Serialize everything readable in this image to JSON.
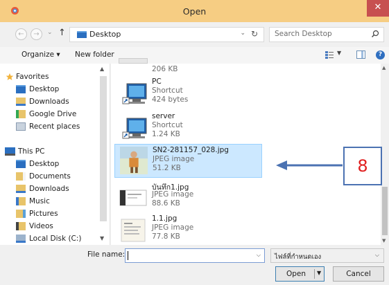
{
  "window": {
    "title": "Open",
    "close_glyph": "✕"
  },
  "navbar": {
    "back_glyph": "←",
    "forward_glyph": "→",
    "recent_glyph": "⌄",
    "up_glyph": "↑",
    "address": "Desktop",
    "refresh_glyph": "↻",
    "search_placeholder": "Search Desktop"
  },
  "toolbar": {
    "organize_label": "Organize ▾",
    "new_folder_label": "New folder",
    "help_glyph": "?"
  },
  "sidebar": {
    "favorites_label": "Favorites",
    "favorites": [
      {
        "label": "Desktop",
        "icon": "desktop-icon"
      },
      {
        "label": "Downloads",
        "icon": "downloads-icon"
      },
      {
        "label": "Google Drive",
        "icon": "google-drive-icon"
      },
      {
        "label": "Recent places",
        "icon": "recent-places-icon"
      }
    ],
    "this_pc_label": "This PC",
    "this_pc": [
      {
        "label": "Desktop",
        "icon": "desktop-icon"
      },
      {
        "label": "Documents",
        "icon": "documents-icon"
      },
      {
        "label": "Downloads",
        "icon": "downloads-icon"
      },
      {
        "label": "Music",
        "icon": "music-icon"
      },
      {
        "label": "Pictures",
        "icon": "pictures-icon"
      },
      {
        "label": "Videos",
        "icon": "videos-icon"
      },
      {
        "label": "Local Disk (C:)",
        "icon": "local-disk-icon"
      }
    ]
  },
  "files": [
    {
      "size": "206 KB"
    },
    {
      "name": "PC",
      "type": "Shortcut",
      "size": "424 bytes",
      "icon": "pc-shortcut-icon"
    },
    {
      "name": "server",
      "type": "Shortcut",
      "size": "1.24 KB",
      "icon": "server-shortcut-icon"
    },
    {
      "name": "SN2-281157_028.jpg",
      "type": "JPEG image",
      "size": "51.2 KB",
      "icon": "photo-thumbnail",
      "selected": true
    },
    {
      "name": "บันทึก1.jpg",
      "type": "JPEG image",
      "size": "88.6 KB",
      "icon": "screenshot-thumbnail"
    },
    {
      "name": "1.1.jpg",
      "type": "JPEG image",
      "size": "77.8 KB",
      "icon": "document-thumbnail"
    }
  ],
  "annotation": {
    "number": "8",
    "color": "#4b72b2",
    "number_color": "#e02020"
  },
  "bottom": {
    "file_name_label": "File name:",
    "file_name_value": "",
    "filter_value": "ไฟล์ที่กำหนดเอง",
    "open_label": "Open",
    "cancel_label": "Cancel"
  },
  "colors": {
    "titlebar": "#f6cd83",
    "close": "#c75050",
    "selection": "#cce8ff"
  }
}
